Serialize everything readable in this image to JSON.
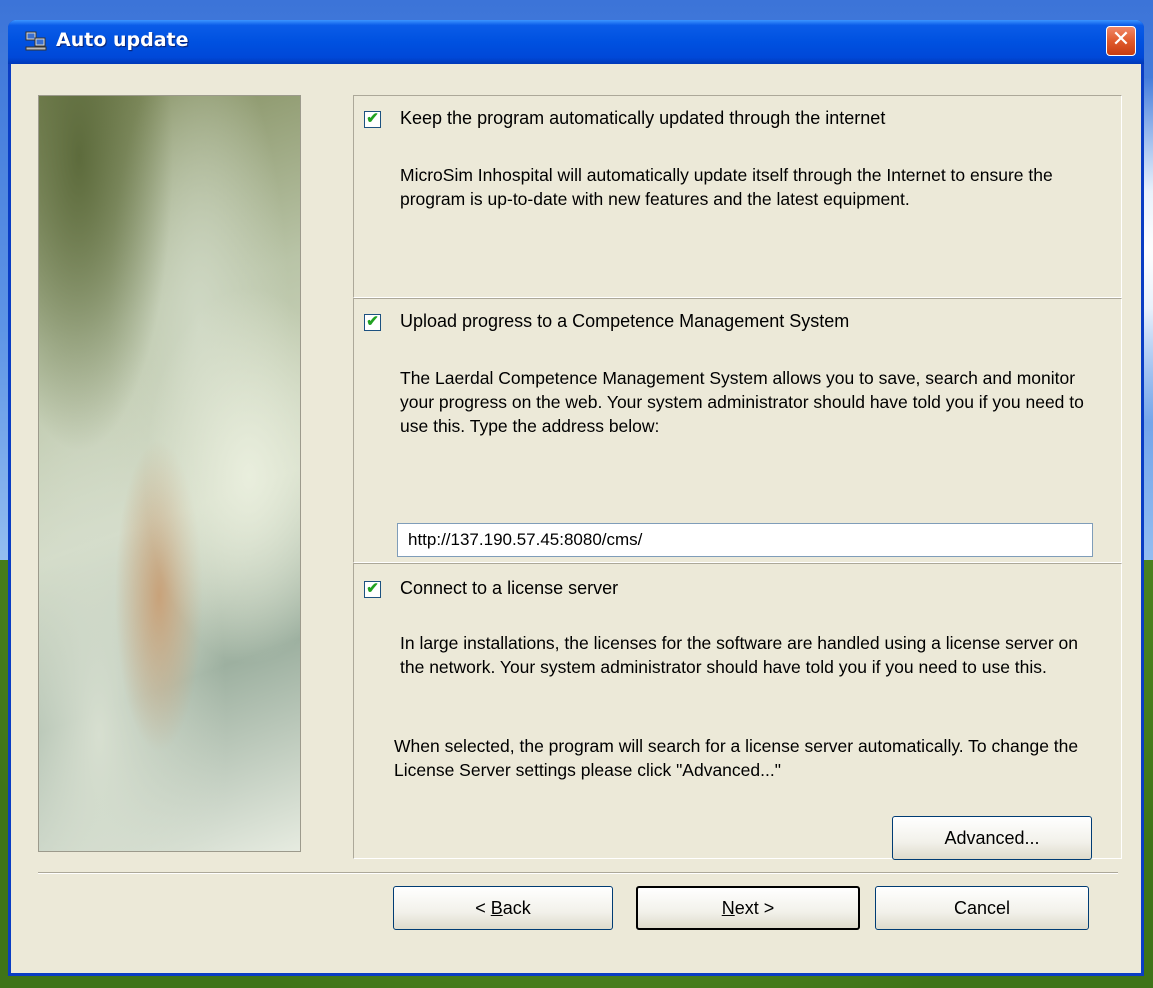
{
  "window": {
    "title": "Auto update",
    "close_label": "✕"
  },
  "sections": [
    {
      "checkbox_label": "Keep the program automatically updated through the internet",
      "checked": true,
      "description": "MicroSim Inhospital will automatically update itself through the Internet to ensure the program is up-to-date with new features and the latest equipment."
    },
    {
      "checkbox_label": "Upload progress to a Competence Management System",
      "checked": true,
      "description": "The Laerdal Competence Management System allows you to save, search and monitor your progress on the web. Your system administrator should have told you if you need to use this. Type the address below:",
      "address_value": "http://137.190.57.45:8080/cms/"
    },
    {
      "checkbox_label": "Connect to a license server",
      "checked": true,
      "description": "In large installations, the licenses for the software are handled using a license server on the network. Your system administrator should have told you if you need to use this.",
      "note": "When selected, the program will search for a license server automatically. To change the License Server settings please click \"Advanced...\"",
      "advanced_label": "Advanced..."
    }
  ],
  "buttons": {
    "back_prefix": "< ",
    "back_mnemonic": "B",
    "back_rest": "ack",
    "next_mnemonic": "N",
    "next_rest": "ext >",
    "cancel": "Cancel"
  },
  "check_mark": "✔"
}
